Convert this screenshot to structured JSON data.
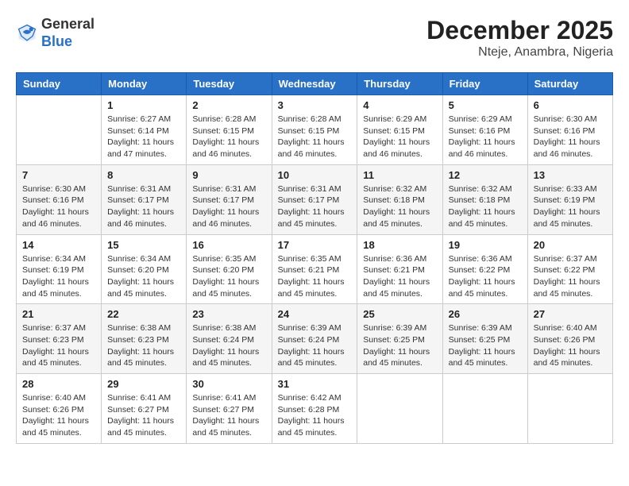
{
  "header": {
    "logo_general": "General",
    "logo_blue": "Blue",
    "month_year": "December 2025",
    "location": "Nteje, Anambra, Nigeria"
  },
  "days_of_week": [
    "Sunday",
    "Monday",
    "Tuesday",
    "Wednesday",
    "Thursday",
    "Friday",
    "Saturday"
  ],
  "weeks": [
    [
      {
        "day": "",
        "sunrise": "",
        "sunset": "",
        "daylight": ""
      },
      {
        "day": "1",
        "sunrise": "Sunrise: 6:27 AM",
        "sunset": "Sunset: 6:14 PM",
        "daylight": "Daylight: 11 hours and 47 minutes."
      },
      {
        "day": "2",
        "sunrise": "Sunrise: 6:28 AM",
        "sunset": "Sunset: 6:15 PM",
        "daylight": "Daylight: 11 hours and 46 minutes."
      },
      {
        "day": "3",
        "sunrise": "Sunrise: 6:28 AM",
        "sunset": "Sunset: 6:15 PM",
        "daylight": "Daylight: 11 hours and 46 minutes."
      },
      {
        "day": "4",
        "sunrise": "Sunrise: 6:29 AM",
        "sunset": "Sunset: 6:15 PM",
        "daylight": "Daylight: 11 hours and 46 minutes."
      },
      {
        "day": "5",
        "sunrise": "Sunrise: 6:29 AM",
        "sunset": "Sunset: 6:16 PM",
        "daylight": "Daylight: 11 hours and 46 minutes."
      },
      {
        "day": "6",
        "sunrise": "Sunrise: 6:30 AM",
        "sunset": "Sunset: 6:16 PM",
        "daylight": "Daylight: 11 hours and 46 minutes."
      }
    ],
    [
      {
        "day": "7",
        "sunrise": "Sunrise: 6:30 AM",
        "sunset": "Sunset: 6:16 PM",
        "daylight": "Daylight: 11 hours and 46 minutes."
      },
      {
        "day": "8",
        "sunrise": "Sunrise: 6:31 AM",
        "sunset": "Sunset: 6:17 PM",
        "daylight": "Daylight: 11 hours and 46 minutes."
      },
      {
        "day": "9",
        "sunrise": "Sunrise: 6:31 AM",
        "sunset": "Sunset: 6:17 PM",
        "daylight": "Daylight: 11 hours and 46 minutes."
      },
      {
        "day": "10",
        "sunrise": "Sunrise: 6:31 AM",
        "sunset": "Sunset: 6:17 PM",
        "daylight": "Daylight: 11 hours and 45 minutes."
      },
      {
        "day": "11",
        "sunrise": "Sunrise: 6:32 AM",
        "sunset": "Sunset: 6:18 PM",
        "daylight": "Daylight: 11 hours and 45 minutes."
      },
      {
        "day": "12",
        "sunrise": "Sunrise: 6:32 AM",
        "sunset": "Sunset: 6:18 PM",
        "daylight": "Daylight: 11 hours and 45 minutes."
      },
      {
        "day": "13",
        "sunrise": "Sunrise: 6:33 AM",
        "sunset": "Sunset: 6:19 PM",
        "daylight": "Daylight: 11 hours and 45 minutes."
      }
    ],
    [
      {
        "day": "14",
        "sunrise": "Sunrise: 6:34 AM",
        "sunset": "Sunset: 6:19 PM",
        "daylight": "Daylight: 11 hours and 45 minutes."
      },
      {
        "day": "15",
        "sunrise": "Sunrise: 6:34 AM",
        "sunset": "Sunset: 6:20 PM",
        "daylight": "Daylight: 11 hours and 45 minutes."
      },
      {
        "day": "16",
        "sunrise": "Sunrise: 6:35 AM",
        "sunset": "Sunset: 6:20 PM",
        "daylight": "Daylight: 11 hours and 45 minutes."
      },
      {
        "day": "17",
        "sunrise": "Sunrise: 6:35 AM",
        "sunset": "Sunset: 6:21 PM",
        "daylight": "Daylight: 11 hours and 45 minutes."
      },
      {
        "day": "18",
        "sunrise": "Sunrise: 6:36 AM",
        "sunset": "Sunset: 6:21 PM",
        "daylight": "Daylight: 11 hours and 45 minutes."
      },
      {
        "day": "19",
        "sunrise": "Sunrise: 6:36 AM",
        "sunset": "Sunset: 6:22 PM",
        "daylight": "Daylight: 11 hours and 45 minutes."
      },
      {
        "day": "20",
        "sunrise": "Sunrise: 6:37 AM",
        "sunset": "Sunset: 6:22 PM",
        "daylight": "Daylight: 11 hours and 45 minutes."
      }
    ],
    [
      {
        "day": "21",
        "sunrise": "Sunrise: 6:37 AM",
        "sunset": "Sunset: 6:23 PM",
        "daylight": "Daylight: 11 hours and 45 minutes."
      },
      {
        "day": "22",
        "sunrise": "Sunrise: 6:38 AM",
        "sunset": "Sunset: 6:23 PM",
        "daylight": "Daylight: 11 hours and 45 minutes."
      },
      {
        "day": "23",
        "sunrise": "Sunrise: 6:38 AM",
        "sunset": "Sunset: 6:24 PM",
        "daylight": "Daylight: 11 hours and 45 minutes."
      },
      {
        "day": "24",
        "sunrise": "Sunrise: 6:39 AM",
        "sunset": "Sunset: 6:24 PM",
        "daylight": "Daylight: 11 hours and 45 minutes."
      },
      {
        "day": "25",
        "sunrise": "Sunrise: 6:39 AM",
        "sunset": "Sunset: 6:25 PM",
        "daylight": "Daylight: 11 hours and 45 minutes."
      },
      {
        "day": "26",
        "sunrise": "Sunrise: 6:39 AM",
        "sunset": "Sunset: 6:25 PM",
        "daylight": "Daylight: 11 hours and 45 minutes."
      },
      {
        "day": "27",
        "sunrise": "Sunrise: 6:40 AM",
        "sunset": "Sunset: 6:26 PM",
        "daylight": "Daylight: 11 hours and 45 minutes."
      }
    ],
    [
      {
        "day": "28",
        "sunrise": "Sunrise: 6:40 AM",
        "sunset": "Sunset: 6:26 PM",
        "daylight": "Daylight: 11 hours and 45 minutes."
      },
      {
        "day": "29",
        "sunrise": "Sunrise: 6:41 AM",
        "sunset": "Sunset: 6:27 PM",
        "daylight": "Daylight: 11 hours and 45 minutes."
      },
      {
        "day": "30",
        "sunrise": "Sunrise: 6:41 AM",
        "sunset": "Sunset: 6:27 PM",
        "daylight": "Daylight: 11 hours and 45 minutes."
      },
      {
        "day": "31",
        "sunrise": "Sunrise: 6:42 AM",
        "sunset": "Sunset: 6:28 PM",
        "daylight": "Daylight: 11 hours and 45 minutes."
      },
      {
        "day": "",
        "sunrise": "",
        "sunset": "",
        "daylight": ""
      },
      {
        "day": "",
        "sunrise": "",
        "sunset": "",
        "daylight": ""
      },
      {
        "day": "",
        "sunrise": "",
        "sunset": "",
        "daylight": ""
      }
    ]
  ]
}
